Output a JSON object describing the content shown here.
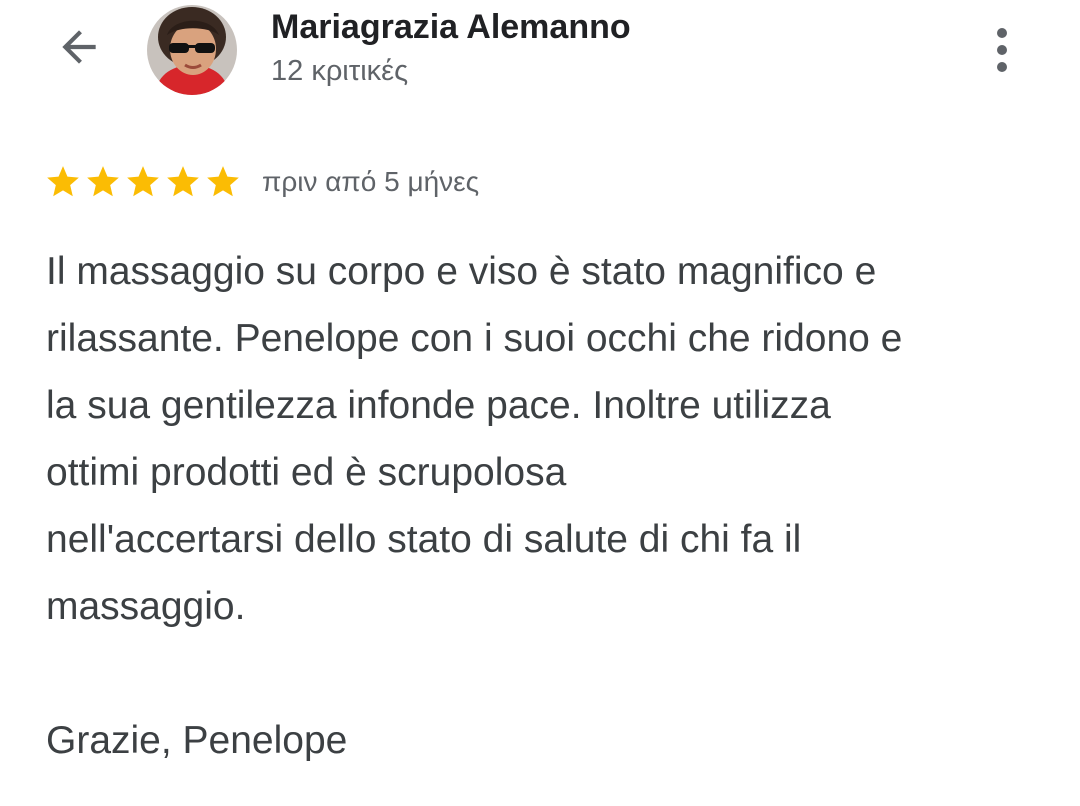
{
  "header": {
    "back_icon": "arrow-left-icon",
    "reviewer_name": "Mariagrazia Alemanno",
    "review_count": "12 κριτικές",
    "more_icon": "more-vert-icon"
  },
  "review": {
    "rating": 5,
    "max_rating": 5,
    "star_color": "#fbbc04",
    "time": "πριν από 5 μήνες",
    "lines": [
      "Il massaggio su corpo e viso è stato magnifico e",
      "rilassante. Penelope con i suoi occhi che ridono e",
      "la sua gentilezza infonde pace. Inoltre utilizza",
      "ottimi prodotti ed è scrupolosa",
      "nell'accertarsi dello stato di salute di chi fa il",
      "massaggio."
    ],
    "signoff": "Grazie, Penelope"
  }
}
